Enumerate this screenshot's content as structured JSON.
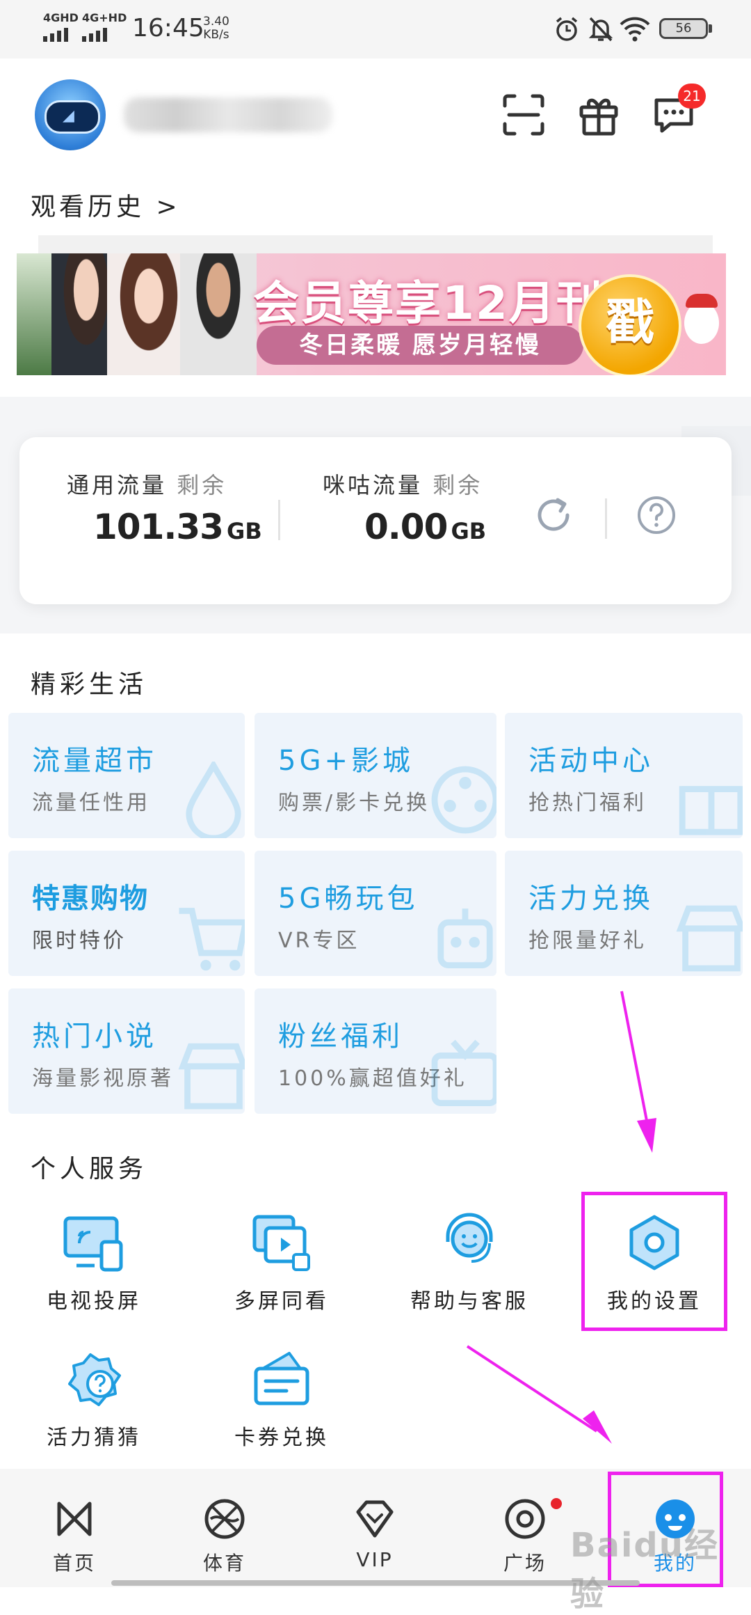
{
  "status_bar": {
    "network1": "4GHD",
    "network2": "4G+HD",
    "time": "16:45",
    "speed_value": "3.40",
    "speed_unit": "KB/s",
    "battery": "56"
  },
  "header": {
    "notification_count": "21"
  },
  "history": {
    "label": "观看历史 >"
  },
  "banner": {
    "title": "会员尊享12月刊",
    "subtitle": "冬日柔暖 愿岁月轻慢",
    "cta": "戳"
  },
  "data_card": {
    "general_label": "通用流量",
    "general_suffix": "剩余",
    "general_value": "101.33",
    "general_unit": "GB",
    "migu_label": "咪咕流量",
    "migu_suffix": "剩余",
    "migu_value": "0.00",
    "migu_unit": "GB"
  },
  "life": {
    "title": "精彩生活",
    "tiles": [
      {
        "title": "流量超市",
        "sub": "流量任性用"
      },
      {
        "title": "5G+影城",
        "sub": "购票/影卡兑换"
      },
      {
        "title": "活动中心",
        "sub": "抢热门福利"
      },
      {
        "title": "特惠购物",
        "sub": "限时特价"
      },
      {
        "title": "5G畅玩包",
        "sub": "VR专区"
      },
      {
        "title": "活力兑换",
        "sub": "抢限量好礼"
      },
      {
        "title": "热门小说",
        "sub": "海量影视原著"
      },
      {
        "title": "粉丝福利",
        "sub": "100%赢超值好礼"
      }
    ]
  },
  "services": {
    "title": "个人服务",
    "items": [
      {
        "label": "电视投屏",
        "icon": "cast-screen-icon"
      },
      {
        "label": "多屏同看",
        "icon": "multi-screen-icon"
      },
      {
        "label": "帮助与客服",
        "icon": "customer-service-icon"
      },
      {
        "label": "我的设置",
        "icon": "settings-icon"
      },
      {
        "label": "活力猜猜",
        "icon": "quiz-icon"
      },
      {
        "label": "卡券兑换",
        "icon": "coupon-icon"
      }
    ]
  },
  "bottom_nav": {
    "items": [
      {
        "label": "首页"
      },
      {
        "label": "体育"
      },
      {
        "label": "VIP"
      },
      {
        "label": "广场"
      },
      {
        "label": "我的"
      }
    ]
  },
  "watermark": "Baidu经验",
  "colors": {
    "accent": "#1e9de0",
    "annotation": "#ee22ee",
    "badge": "#f52a2a"
  }
}
